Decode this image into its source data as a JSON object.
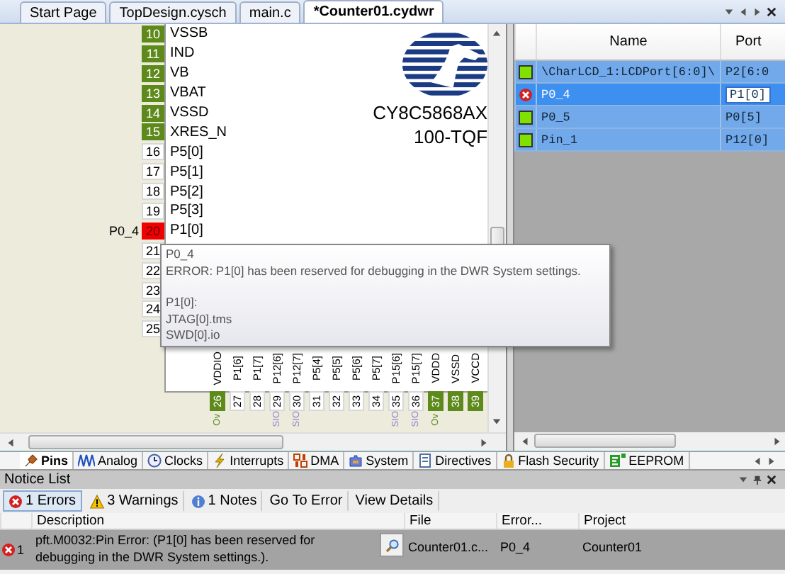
{
  "tabs": [
    {
      "label": "Start Page",
      "selected": false
    },
    {
      "label": "TopDesign.cysch",
      "selected": false
    },
    {
      "label": "main.c",
      "selected": false
    },
    {
      "label": "*Counter01.cydwr",
      "selected": true
    }
  ],
  "chip": {
    "part_number": "CY8C5868AX",
    "package": "100-TQF",
    "left_pins": [
      {
        "number": "10",
        "name": "VSSB",
        "kind": "power"
      },
      {
        "number": "11",
        "name": "IND",
        "kind": "power"
      },
      {
        "number": "12",
        "name": "VB",
        "kind": "power"
      },
      {
        "number": "13",
        "name": "VBAT",
        "kind": "power"
      },
      {
        "number": "14",
        "name": "VSSD",
        "kind": "power"
      },
      {
        "number": "15",
        "name": "XRES_N",
        "kind": "power"
      },
      {
        "number": "16",
        "name": "P5[0]",
        "kind": "io"
      },
      {
        "number": "17",
        "name": "P5[1]",
        "kind": "io"
      },
      {
        "number": "18",
        "name": "P5[2]",
        "kind": "io"
      },
      {
        "number": "19",
        "name": "P5[3]",
        "kind": "io"
      },
      {
        "number": "20",
        "name": "P1[0]",
        "kind": "error",
        "assigned": "P0_4"
      },
      {
        "number": "21",
        "kind": "io"
      },
      {
        "number": "22",
        "kind": "io"
      },
      {
        "number": "23",
        "kind": "io"
      },
      {
        "number": "24",
        "kind": "io"
      },
      {
        "number": "25",
        "kind": "io"
      }
    ],
    "bottom_pins": [
      {
        "number": "26",
        "name": "VDDIO",
        "kind": "power",
        "note": {
          "text": "Ov",
          "color": "#5e8a1c"
        }
      },
      {
        "number": "27",
        "name": "P1[6]",
        "kind": "io"
      },
      {
        "number": "28",
        "name": "P1[7]",
        "kind": "io"
      },
      {
        "number": "29",
        "name": "P12[6]",
        "kind": "io",
        "note": {
          "text": "SIO",
          "color": "#9a80d0"
        }
      },
      {
        "number": "30",
        "name": "P12[7]",
        "kind": "io",
        "note": {
          "text": "SIO",
          "color": "#9a80d0"
        }
      },
      {
        "number": "31",
        "name": "P5[4]",
        "kind": "io"
      },
      {
        "number": "32",
        "name": "P5[5]",
        "kind": "io"
      },
      {
        "number": "33",
        "name": "P5[6]",
        "kind": "io"
      },
      {
        "number": "34",
        "name": "P5[7]",
        "kind": "io"
      },
      {
        "number": "35",
        "name": "P15[6]",
        "kind": "io",
        "note": {
          "text": "SIO",
          "color": "#9a80d0"
        }
      },
      {
        "number": "36",
        "name": "P15[7]",
        "kind": "io",
        "note": {
          "text": "SIO",
          "color": "#9a80d0"
        }
      },
      {
        "number": "37",
        "name": "VDDD",
        "kind": "power",
        "note": {
          "text": "Ov",
          "color": "#5e8a1c"
        }
      },
      {
        "number": "38",
        "name": "VSSD",
        "kind": "power"
      },
      {
        "number": "39",
        "name": "VCCD",
        "kind": "power"
      }
    ]
  },
  "tooltip": {
    "title": "P0_4",
    "message": "ERROR: P1[0] has been reserved for debugging in the DWR System settings.",
    "details": [
      "P1[0]:",
      "JTAG[0].tms",
      "SWD[0].io"
    ]
  },
  "pin_table": {
    "columns": [
      "Name",
      "Port"
    ],
    "rows": [
      {
        "name": "\\CharLCD_1:LCDPort[6:0]\\",
        "port": "P2[6:0",
        "error": false,
        "selected": false
      },
      {
        "name": "P0_4",
        "port": "P1[0]",
        "error": true,
        "selected": true
      },
      {
        "name": "P0_5",
        "port": "P0[5]",
        "error": false,
        "selected": false
      },
      {
        "name": "Pin_1",
        "port": "P12[0]",
        "error": false,
        "selected": false
      }
    ]
  },
  "view_tabs": [
    {
      "label": "Pins",
      "kind": "pins",
      "selected": true
    },
    {
      "label": "Analog",
      "kind": "analog",
      "selected": false
    },
    {
      "label": "Clocks",
      "kind": "clocks",
      "selected": false
    },
    {
      "label": "Interrupts",
      "kind": "interrupts",
      "selected": false
    },
    {
      "label": "DMA",
      "kind": "dma",
      "selected": false
    },
    {
      "label": "System",
      "kind": "system",
      "selected": false
    },
    {
      "label": "Directives",
      "kind": "directives",
      "selected": false
    },
    {
      "label": "Flash Security",
      "kind": "flash",
      "selected": false
    },
    {
      "label": "EEPROM",
      "kind": "eeprom",
      "selected": false
    }
  ],
  "notice_list": {
    "title": "Notice List",
    "filters": [
      {
        "label": "1 Errors",
        "kind": "error",
        "selected": true
      },
      {
        "label": "3 Warnings",
        "kind": "warning",
        "selected": false
      },
      {
        "label": "1 Notes",
        "kind": "note",
        "selected": false
      }
    ],
    "actions": [
      "Go To Error",
      "View Details"
    ],
    "columns": [
      "Description",
      "File",
      "Error...",
      "Project"
    ],
    "rows": [
      {
        "error": true,
        "number": "1",
        "description": "pft.M0032:Pin Error: (P1[0] has been reserved for debugging in the DWR System settings.).",
        "file": "Counter01.c...",
        "error_pin": "P0_4",
        "project": "Counter01"
      }
    ]
  }
}
